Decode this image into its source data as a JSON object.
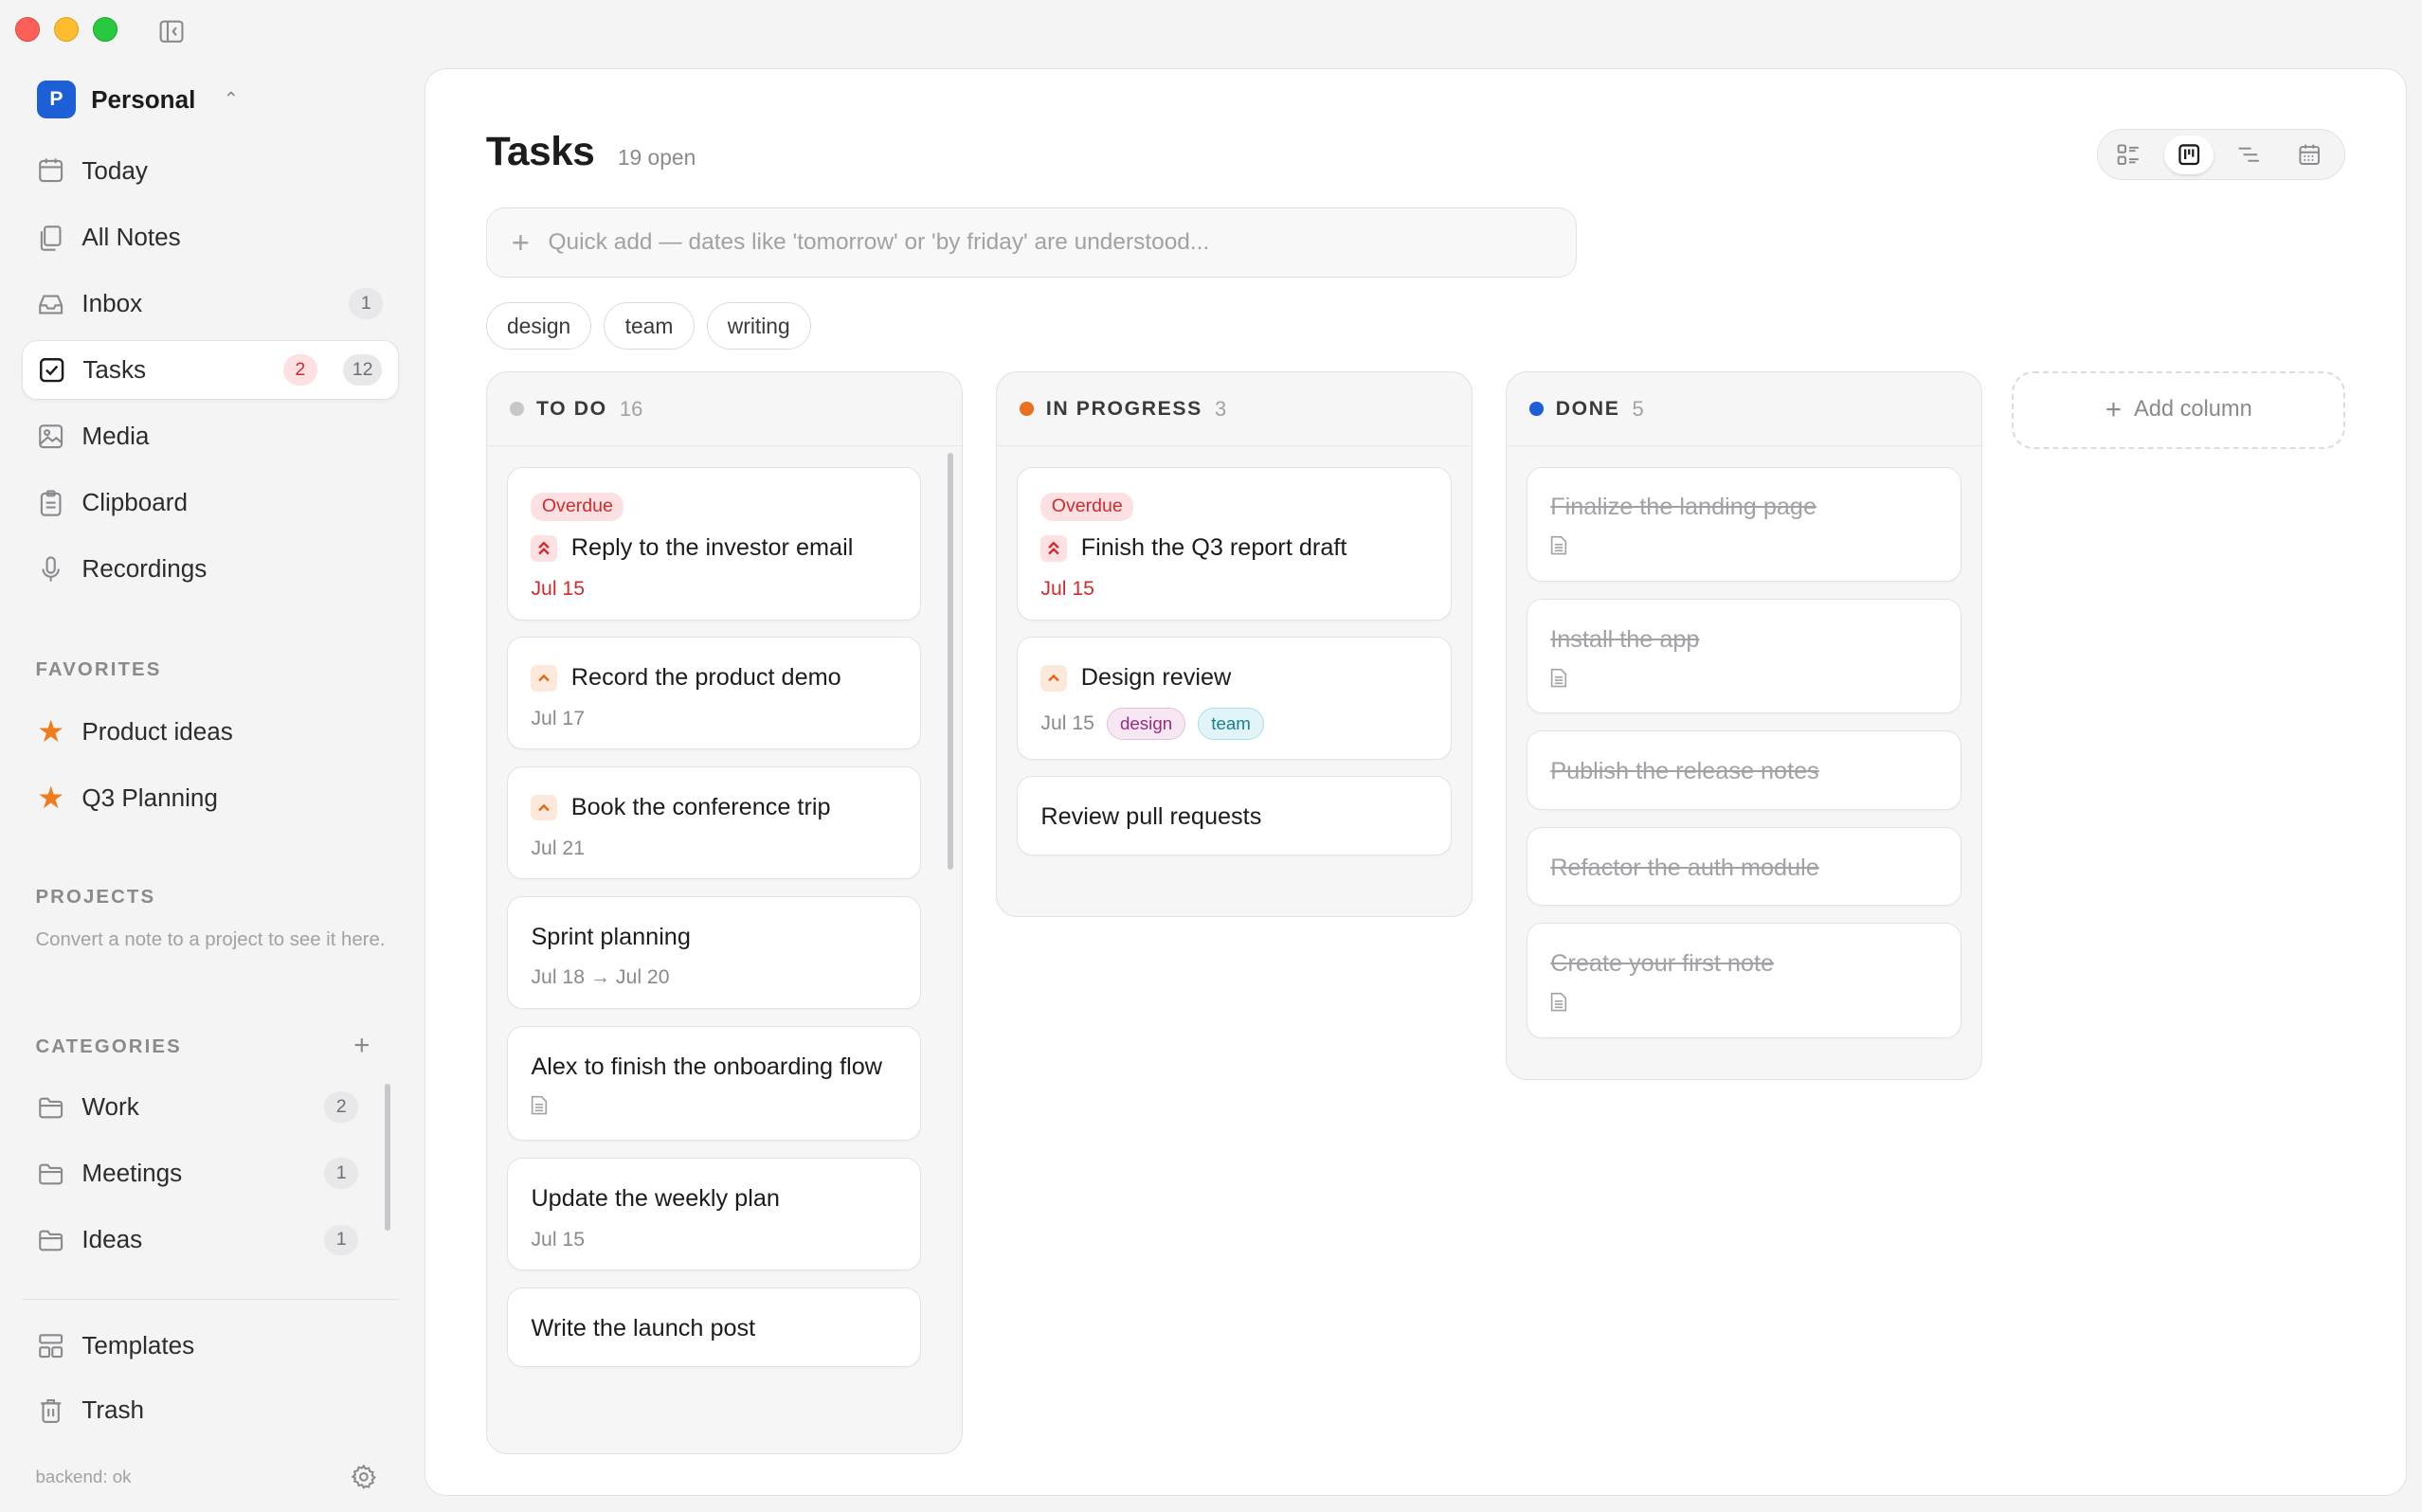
{
  "workspace": {
    "initial": "P",
    "name": "Personal"
  },
  "nav": [
    {
      "id": "today",
      "label": "Today",
      "icon": "calendar-icon"
    },
    {
      "id": "all-notes",
      "label": "All Notes",
      "icon": "notes-icon"
    },
    {
      "id": "inbox",
      "label": "Inbox",
      "icon": "inbox-icon",
      "count": "1"
    },
    {
      "id": "tasks",
      "label": "Tasks",
      "icon": "checkbox-icon",
      "overdue": "2",
      "count": "12",
      "active": true
    },
    {
      "id": "media",
      "label": "Media",
      "icon": "image-icon"
    },
    {
      "id": "clipboard",
      "label": "Clipboard",
      "icon": "clipboard-icon"
    },
    {
      "id": "recordings",
      "label": "Recordings",
      "icon": "microphone-icon"
    }
  ],
  "favorites": {
    "title": "FAVORITES",
    "items": [
      {
        "label": "Product ideas"
      },
      {
        "label": "Q3 Planning"
      }
    ]
  },
  "projects": {
    "title": "PROJECTS",
    "hint": "Convert a note to a project to see it here."
  },
  "categories": {
    "title": "CATEGORIES",
    "items": [
      {
        "label": "Work",
        "count": "2"
      },
      {
        "label": "Meetings",
        "count": "1"
      },
      {
        "label": "Ideas",
        "count": "1"
      }
    ]
  },
  "footer_nav": [
    {
      "label": "Templates"
    },
    {
      "label": "Trash"
    }
  ],
  "status": {
    "backend": "backend: ok"
  },
  "page": {
    "title": "Tasks",
    "open_count": "19 open",
    "quick_add_placeholder": "Quick add — dates like 'tomorrow' or 'by friday' are understood...",
    "view_modes": [
      "list-view-icon",
      "board-view-icon",
      "timeline-view-icon",
      "calendar-view-icon"
    ],
    "active_view": "board",
    "filter_tags": [
      "design",
      "team",
      "writing"
    ]
  },
  "board": {
    "columns": [
      {
        "name": "TO DO",
        "count": "16",
        "dot_color": "#c7c7cc",
        "cards": [
          {
            "badge": "Overdue",
            "priority": "high",
            "title": "Reply to the investor email",
            "date": "Jul 15",
            "overdue": true
          },
          {
            "priority": "medium",
            "title": "Record the product demo",
            "date": "Jul 17"
          },
          {
            "priority": "medium",
            "title": "Book the conference trip",
            "date": "Jul 21"
          },
          {
            "title": "Sprint planning",
            "date": "Jul 18 → Jul 20"
          },
          {
            "title": "Alex to finish the onboarding flow",
            "has_note": true
          },
          {
            "title": "Update the weekly plan",
            "date": "Jul 15"
          },
          {
            "title": "Write the launch post"
          }
        ]
      },
      {
        "name": "IN PROGRESS",
        "count": "3",
        "dot_color": "#e8701e",
        "cards": [
          {
            "badge": "Overdue",
            "priority": "high",
            "title": "Finish the Q3 report draft",
            "date": "Jul 15",
            "overdue": true
          },
          {
            "priority": "medium",
            "title": "Design review",
            "date": "Jul 15",
            "tags": [
              "design",
              "team"
            ]
          },
          {
            "title": "Review pull requests"
          }
        ]
      },
      {
        "name": "DONE",
        "count": "5",
        "dot_color": "#1d5fd6",
        "cards": [
          {
            "title": "Finalize the landing page",
            "has_note": true
          },
          {
            "title": "Install the app",
            "has_note": true
          },
          {
            "title": "Publish the release notes"
          },
          {
            "title": "Refactor the auth module"
          },
          {
            "title": "Create your first note",
            "has_note": true
          }
        ]
      }
    ],
    "add_column_label": "Add column"
  }
}
